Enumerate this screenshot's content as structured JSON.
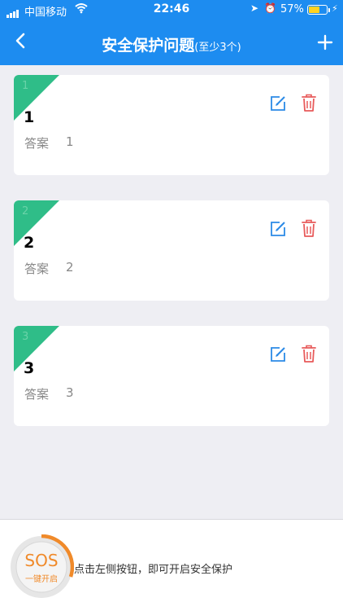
{
  "status_bar": {
    "carrier": "中国移动",
    "time": "22:46",
    "battery_percent": "57%",
    "battery_level": 0.57
  },
  "nav": {
    "title": "安全保护问题",
    "subtitle": "(至少3个)"
  },
  "questions": [
    {
      "index": "1",
      "question": "1",
      "answer_label": "答案",
      "answer": "1"
    },
    {
      "index": "2",
      "question": "2",
      "answer_label": "答案",
      "answer": "2"
    },
    {
      "index": "3",
      "question": "3",
      "answer_label": "答案",
      "answer": "3"
    }
  ],
  "bottom": {
    "sos_label": "SOS",
    "sos_sub": "一键开启",
    "hint": "点击左侧按钮，即可开启安全保护"
  },
  "colors": {
    "primary": "#1d8cf0",
    "corner_green": "#2fbd88",
    "delete_red": "#e85a5a",
    "sos_orange": "#f08a2a",
    "background": "#eeeef3"
  },
  "icons": {
    "back": "chevron-left-icon",
    "add": "plus-icon",
    "edit": "edit-icon",
    "delete": "trash-icon",
    "wifi": "wifi-icon",
    "location": "location-arrow-icon",
    "alarm": "alarm-clock-icon"
  }
}
